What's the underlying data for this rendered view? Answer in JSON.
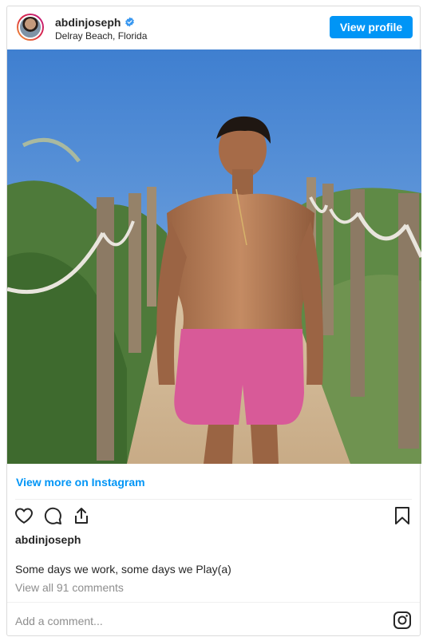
{
  "post": {
    "username": "abdinjoseph",
    "location": "Delray Beach, Florida",
    "view_profile_label": "View profile",
    "view_more_label": "View more on Instagram",
    "likes_username": "abdinjoseph",
    "caption": "Some days we work, some days we Play(a)",
    "comments_link": "View all 91 comments",
    "add_comment_placeholder": "Add a comment..."
  },
  "colors": {
    "accent": "#0095f6",
    "verified": "#3897f0",
    "text": "#262626",
    "muted": "#8e8e8e",
    "border": "#dbdbdb"
  },
  "icons": {
    "verified": "verified-badge-icon",
    "like": "heart-icon",
    "comment": "comment-bubble-icon",
    "share": "share-icon",
    "save": "bookmark-icon",
    "instagram": "instagram-logo-icon"
  }
}
